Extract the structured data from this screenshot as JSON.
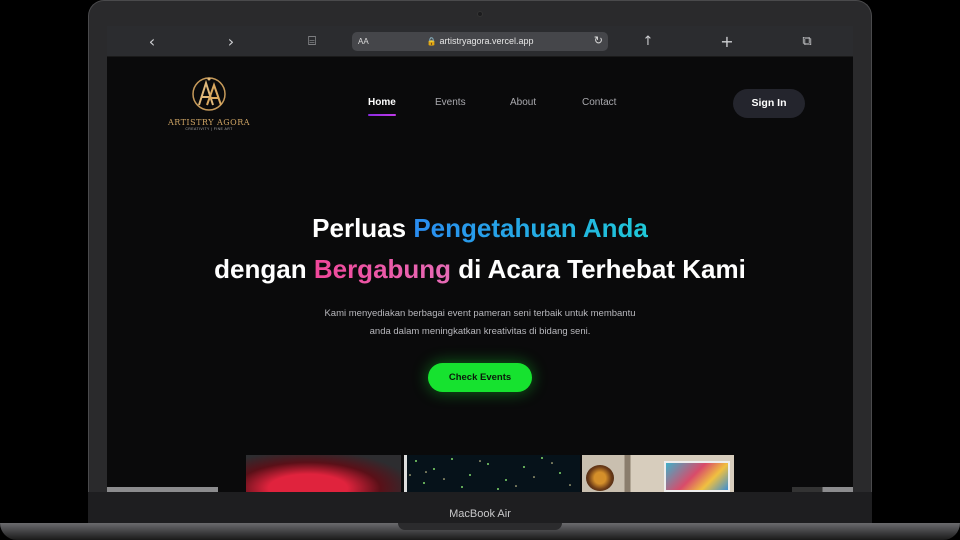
{
  "browser": {
    "back_icon": "chevron-left-icon",
    "forward_icon": "chevron-right-icon",
    "reader_mode": "AA",
    "url": "artistryagora.vercel.app",
    "lock_icon": "lock-icon",
    "reload_icon": "reload-icon",
    "glyphs": {
      "back": "‹",
      "forward": "›",
      "bookmarks": "⌸",
      "lock": "🔒",
      "reload": "↻",
      "share": "↑",
      "new_tab": "+",
      "tabs": "⧉"
    }
  },
  "site": {
    "logo": {
      "name": "ARTISTRY AGORA",
      "tagline": "CREATIVITY | FINE ART",
      "sub": "CREATIVITY | FINE ART"
    },
    "nav": [
      {
        "label": "Home",
        "active": true
      },
      {
        "label": "Events",
        "active": false
      },
      {
        "label": "About",
        "active": false
      },
      {
        "label": "Contact",
        "active": false
      }
    ],
    "signin_label": "Sign In",
    "hero": {
      "line1_prefix": "Perluas ",
      "line1_highlight": "Pengetahuan Anda",
      "line2_prefix": "dengan ",
      "line2_highlight": "Bergabung",
      "line2_suffix": " di Acara Terhebat Kami",
      "desc_line1": "Kami menyediakan berbagai event pameran seni terbaik untuk membantu",
      "desc_line2": "anda dalam meningkatkan kreativitas di bidang seni.",
      "cta_label": "Check Events"
    },
    "colors": {
      "accent_blue": "#2a8cf0",
      "accent_pink": "#f0479a",
      "cta_green": "#16e22f",
      "nav_underline": "#8a2be2"
    }
  },
  "device": {
    "brand": "MacBook Air"
  }
}
